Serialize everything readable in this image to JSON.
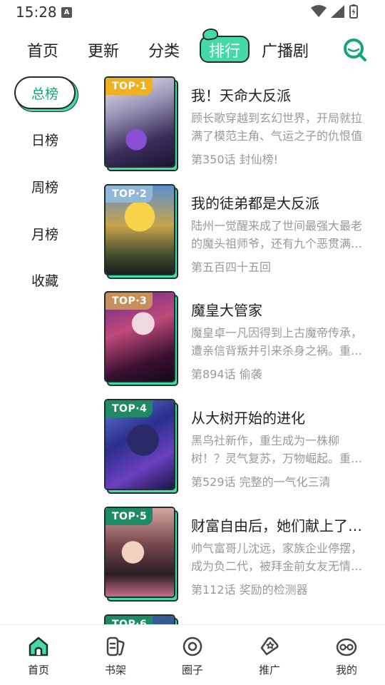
{
  "status_bar": {
    "time": "15:28",
    "notification_icon": "A"
  },
  "top_nav": {
    "tabs": [
      {
        "label": "首页",
        "active": false
      },
      {
        "label": "更新",
        "active": false
      },
      {
        "label": "分类",
        "active": false
      },
      {
        "label": "排行",
        "active": true
      },
      {
        "label": "广播剧",
        "active": false
      }
    ],
    "search_icon": "search-icon",
    "accent_color": "#46d9a8"
  },
  "sidebar": {
    "items": [
      {
        "label": "总榜",
        "active": true
      },
      {
        "label": "日榜",
        "active": false
      },
      {
        "label": "周榜",
        "active": false
      },
      {
        "label": "月榜",
        "active": false
      },
      {
        "label": "收藏",
        "active": false
      }
    ]
  },
  "ranking": {
    "items": [
      {
        "rank": "TOP·1",
        "badge_color": "#f0b020",
        "title": "我！天命大反派",
        "description": "顾长歌穿越到玄幻世界，开局就拉满了模范主角、气运之子的仇恨值",
        "episode": "第350话 封仙榜!"
      },
      {
        "rank": "TOP·2",
        "badge_color": "#8fb8d6",
        "title": "我的徒弟都是大反派",
        "description": "陆州一觉醒来成了世间最强大最老的魔头祖师爷，还有九个恶贯满盈的徒弟",
        "episode": "第五百四十五回"
      },
      {
        "rank": "TOP·3",
        "badge_color": "#c6905c",
        "title": "魔皇大管家",
        "description": "魔皇卓一凡因得到上古魔帝传承，遭亲信背叛并引来杀身之祸。重生之后",
        "episode": "第894话 偷袭"
      },
      {
        "rank": "TOP·4",
        "badge_color": "#1f8a66",
        "title": "从大树开始的进化",
        "description": "黑鸟社新作，重生成为一株柳树！？灵气复苏，万物崛起。重生为树",
        "episode": "第529话 完整的一气化三清"
      },
      {
        "rank": "TOP·5",
        "badge_color": "#1f8a66",
        "title": "财富自由后，她们献上了忠诚",
        "description": "帅气富哥儿沈远，家族企业停摆，成为负二代，被拜金前女友无情抛弃",
        "episode": "第112话 奖励的检测器"
      },
      {
        "rank": "TOP·6",
        "badge_color": "#1f8a66",
        "title": "",
        "description": "",
        "episode": ""
      }
    ]
  },
  "bottom_nav": {
    "items": [
      {
        "label": "首页",
        "icon": "home-icon",
        "active": true
      },
      {
        "label": "书架",
        "icon": "bookshelf-icon",
        "active": false
      },
      {
        "label": "圈子",
        "icon": "circle-icon",
        "active": false
      },
      {
        "label": "推广",
        "icon": "promote-icon",
        "active": false
      },
      {
        "label": "我的",
        "icon": "profile-icon",
        "active": false
      }
    ]
  }
}
